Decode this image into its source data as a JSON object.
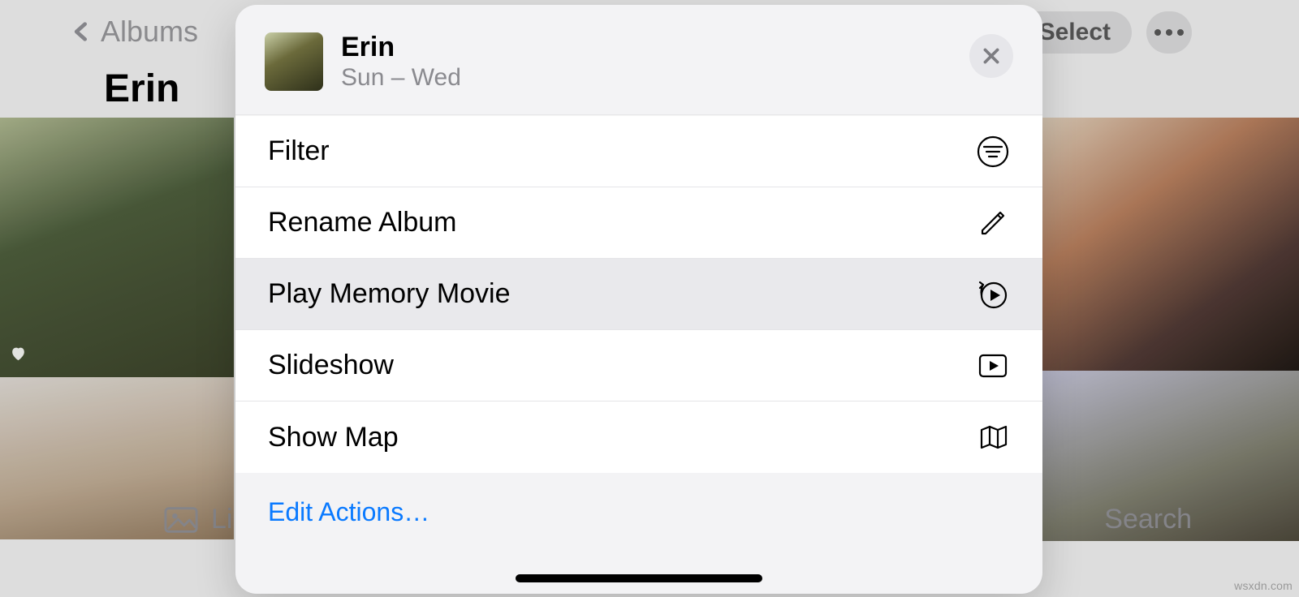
{
  "nav": {
    "back_label": "Albums",
    "album_title": "Erin",
    "select_button": "Select"
  },
  "sheet": {
    "title": "Erin",
    "subtitle": "Sun – Wed",
    "items": {
      "filter": "Filter",
      "rename": "Rename Album",
      "play_memory": "Play Memory Movie",
      "slideshow": "Slideshow",
      "show_map": "Show Map"
    },
    "edit_actions": "Edit Actions…"
  },
  "tabs": {
    "left_partial": "Li",
    "search": "Search"
  },
  "watermark": "wsxdn.com"
}
